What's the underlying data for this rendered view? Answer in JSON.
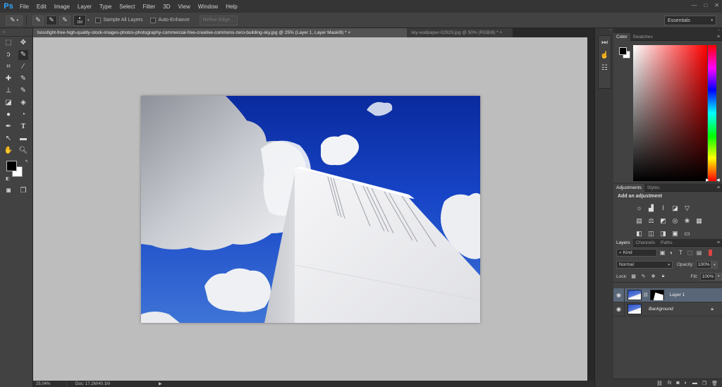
{
  "app": {
    "logo": "Ps"
  },
  "menu": [
    "File",
    "Edit",
    "Image",
    "Layer",
    "Type",
    "Select",
    "Filter",
    "3D",
    "View",
    "Window",
    "Help"
  ],
  "window_controls": {
    "minimize": "—",
    "restore": "□",
    "close": "✕"
  },
  "options": {
    "brush_size": "150",
    "sample_all_layers": "Sample All Layers",
    "auto_enhance": "Auto-Enhance",
    "refine_edge": "Refine Edge...",
    "workspace": "Essentials"
  },
  "tabs": [
    {
      "label": "bossfight-free-high-quality-stock-images-photos-photography-commercial-free-creative-commons-zero-building-sky.jpg @ 25% (Layer 1, Layer Mask/8) *",
      "close": "×"
    },
    {
      "label": "sky-wallpaper-02929.jpg @ 50% (RGB/8) *",
      "close": "×"
    }
  ],
  "status": {
    "zoom": "25.04%",
    "doc": "Doc: 17.2M/40.1M"
  },
  "color_panel": {
    "tabs": [
      "Color",
      "Swatches"
    ]
  },
  "adjustments_panel": {
    "tabs": [
      "Adjustments",
      "Styles"
    ],
    "title": "Add an adjustment"
  },
  "layers_panel": {
    "tabs": [
      "Layers",
      "Channels",
      "Paths"
    ],
    "kind_filter": "Kind",
    "blend_mode": "Normal",
    "opacity_label": "Opacity:",
    "opacity": "100%",
    "lock_label": "Lock:",
    "fill_label": "Fill:",
    "fill": "100%",
    "layers": [
      {
        "name": "Layer 1"
      },
      {
        "name": "Background"
      }
    ]
  },
  "icons": {
    "selection": "brush-selection",
    "accent_blue": "#31a8ff",
    "selected_layer_bg": "#596678"
  }
}
